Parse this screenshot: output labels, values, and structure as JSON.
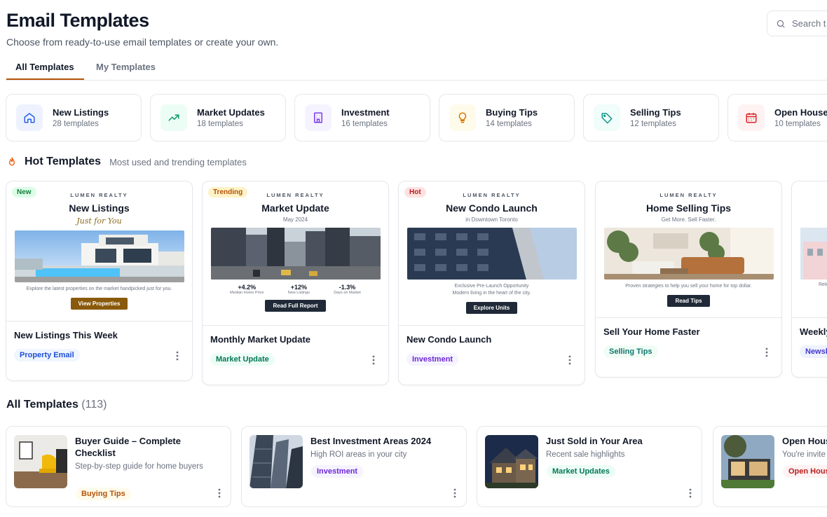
{
  "header": {
    "title": "Email Templates",
    "subtitle": "Choose from ready-to-use email templates or create your own.",
    "search_placeholder": "Search t"
  },
  "tabs": [
    {
      "label": "All Templates",
      "active": true
    },
    {
      "label": "My Templates",
      "active": false
    }
  ],
  "categories": [
    {
      "name": "New Listings",
      "count": "28 templates",
      "icon": "home-icon",
      "color": "#2563eb",
      "bg": "#eef2ff"
    },
    {
      "name": "Market Updates",
      "count": "18 templates",
      "icon": "trending-up-icon",
      "color": "#059669",
      "bg": "#ecfdf5"
    },
    {
      "name": "Investment",
      "count": "16 templates",
      "icon": "building-icon",
      "color": "#7c3aed",
      "bg": "#f5f3ff"
    },
    {
      "name": "Buying Tips",
      "count": "14 templates",
      "icon": "lightbulb-icon",
      "color": "#d97706",
      "bg": "#fffbeb"
    },
    {
      "name": "Selling Tips",
      "count": "12 templates",
      "icon": "tag-icon",
      "color": "#0d9488",
      "bg": "#f0fdfa"
    },
    {
      "name": "Open House",
      "count": "10 templates",
      "icon": "calendar-icon",
      "color": "#dc2626",
      "bg": "#fef2f2"
    }
  ],
  "hot": {
    "title": "Hot Templates",
    "subtitle": "Most used and trending templates",
    "cards": [
      {
        "badge": "New",
        "brand": "LUMEN REALTY",
        "preview_title": "New Listings",
        "preview_script": "Just for You",
        "preview_desc": "Explore the latest properties on the market handpicked just for you.",
        "preview_button": "View Properties",
        "title": "New Listings This Week",
        "tag": "Property Email"
      },
      {
        "badge": "Trending",
        "brand": "LUMEN REALTY",
        "preview_title": "Market Update",
        "preview_sub": "May 2024",
        "stats": [
          {
            "value": "+4.2%",
            "label": "Median Home Price"
          },
          {
            "value": "+12%",
            "label": "New Listings"
          },
          {
            "value": "-1.3%",
            "label": "Days on Market"
          }
        ],
        "preview_button": "Read Full Report",
        "title": "Monthly Market Update",
        "tag": "Market Update"
      },
      {
        "badge": "Hot",
        "brand": "LUMEN REALTY",
        "preview_title": "New Condo Launch",
        "preview_sub": "in Downtown Toronto",
        "preview_desc_1": "Exclusive Pre-Launch Opportunity",
        "preview_desc_2": "Modern living in the heart of the city.",
        "preview_button": "Explore Units",
        "title": "New Condo Launch",
        "tag": "Investment"
      },
      {
        "brand": "LUMEN REALTY",
        "preview_title": "Home Selling Tips",
        "preview_sub": "Get More. Sell Faster.",
        "preview_desc": "Proven strategies to help you sell your home for top dollar.",
        "preview_button": "Read Tips",
        "title": "Sell Your Home Faster",
        "tag": "Selling Tips"
      },
      {
        "preview_desc": "Rele",
        "title": "Weekly",
        "tag": "Newsl"
      }
    ]
  },
  "all": {
    "title": "All Templates",
    "count": "(113)",
    "cards": [
      {
        "title": "Buyer Guide – Complete Checklist",
        "desc": "Step-by-step guide for home buyers",
        "tag": "Buying Tips"
      },
      {
        "title": "Best Investment Areas 2024",
        "desc": "High ROI areas in your city",
        "tag": "Investment"
      },
      {
        "title": "Just Sold in Your Area",
        "desc": "Recent sale highlights",
        "tag": "Market Updates"
      },
      {
        "title": "Open Hous",
        "desc": "You're invite",
        "tag": "Open Hous"
      }
    ]
  }
}
